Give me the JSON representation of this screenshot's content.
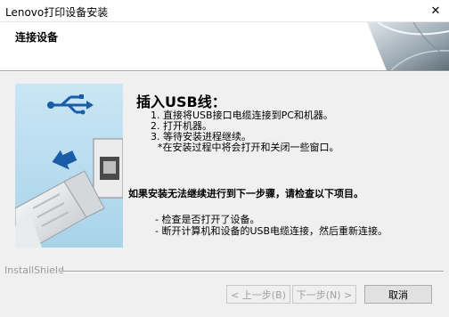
{
  "window": {
    "title": "Lenovo打印设备安装",
    "close_glyph": "✕"
  },
  "header": {
    "title": "连接设备"
  },
  "content": {
    "heading": "插入USB线：",
    "steps": [
      "1. 直接将USB接口电缆连接到PC和机器。",
      "2. 打开机器。",
      "3. 等待安装进程继续。",
      "*在安装过程中将会打开和关闭一些窗口。"
    ],
    "warning": "如果安装无法继续进行到下一步骤，请检查以下项目。",
    "bullets": [
      "- 检查是否打开了设备。",
      "- 断开计算机和设备的USB电缆连接，然后重新连接。"
    ]
  },
  "footer": {
    "brand": "InstallShield",
    "back_label": "< 上一步(B)",
    "next_label": "下一步(N) >",
    "cancel_label": "取消"
  },
  "icons": {
    "usb_symbol": "usb-icon",
    "arrow": "arrow-right-icon",
    "plug": "usb-plug-icon"
  },
  "colors": {
    "side_panel": "#b9dcee",
    "arrow_blue": "#1a5ca8",
    "button_border": "#adadad"
  }
}
